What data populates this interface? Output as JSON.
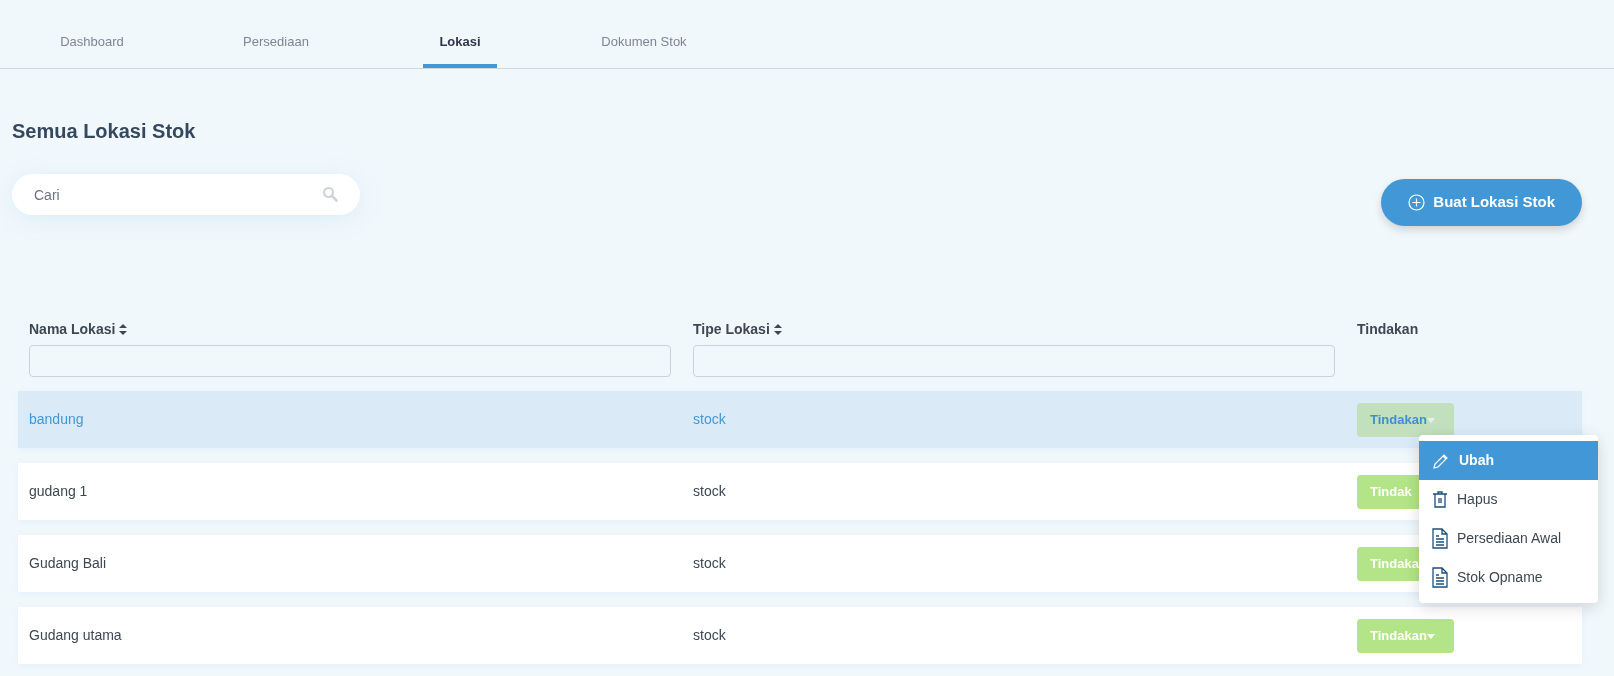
{
  "tabs": [
    {
      "label": "Dashboard",
      "selected": false
    },
    {
      "label": "Persediaan",
      "selected": false
    },
    {
      "label": "Lokasi",
      "selected": true
    },
    {
      "label": "Dokumen Stok",
      "selected": false
    }
  ],
  "title": "Semua Lokasi Stok",
  "search": {
    "placeholder": "Cari"
  },
  "create_button": {
    "label": "Buat Lokasi Stok"
  },
  "table": {
    "columns": [
      {
        "label": "Nama Lokasi",
        "sortable": true,
        "filter": true
      },
      {
        "label": "Tipe Lokasi",
        "sortable": true,
        "filter": true
      },
      {
        "label": "Tindakan",
        "sortable": false,
        "filter": false
      }
    ],
    "rows": [
      {
        "name": "bandung",
        "type": "stock",
        "selected": true,
        "action": {
          "label": "Tindakan"
        }
      },
      {
        "name": "gudang 1",
        "type": "stock",
        "selected": false,
        "action": {
          "label": "Tindak"
        }
      },
      {
        "name": "Gudang Bali",
        "type": "stock",
        "selected": false,
        "action": {
          "label": "Tindaka"
        }
      },
      {
        "name": "Gudang utama",
        "type": "stock",
        "selected": false,
        "action": {
          "label": "Tindakan"
        }
      }
    ]
  },
  "action_menu": {
    "items": [
      {
        "label": "Ubah",
        "kind": "edit",
        "selected": true
      },
      {
        "label": "Hapus",
        "kind": "delete",
        "selected": false
      },
      {
        "label": "Persediaan Awal",
        "kind": "document",
        "selected": false
      },
      {
        "label": "Stok Opname",
        "kind": "document",
        "selected": false
      }
    ]
  }
}
